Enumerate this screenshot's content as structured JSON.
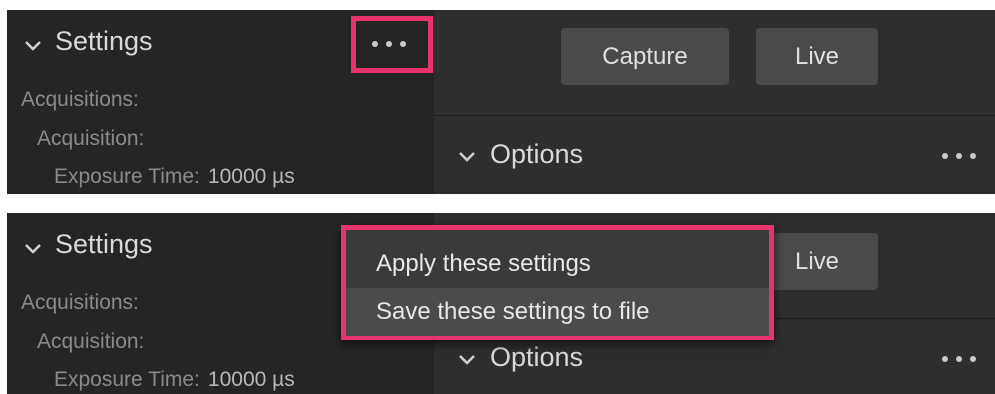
{
  "settings": {
    "title": "Settings",
    "acquisitions_label": "Acquisitions:",
    "acquisition_label": "Acquisition:",
    "exposure_label": "Exposure Time:",
    "exposure_value": "10000 µs"
  },
  "toolbar": {
    "capture_label": "Capture",
    "live_label": "Live"
  },
  "options": {
    "title": "Options"
  },
  "context_menu": {
    "items": [
      {
        "label": "Apply these settings"
      },
      {
        "label": "Save these settings to file"
      }
    ]
  },
  "colors": {
    "highlight": "#e8336d",
    "panel_bg": "#2e2e2e",
    "sidebar_bg": "#252525",
    "button_bg": "#4a4a4a"
  }
}
